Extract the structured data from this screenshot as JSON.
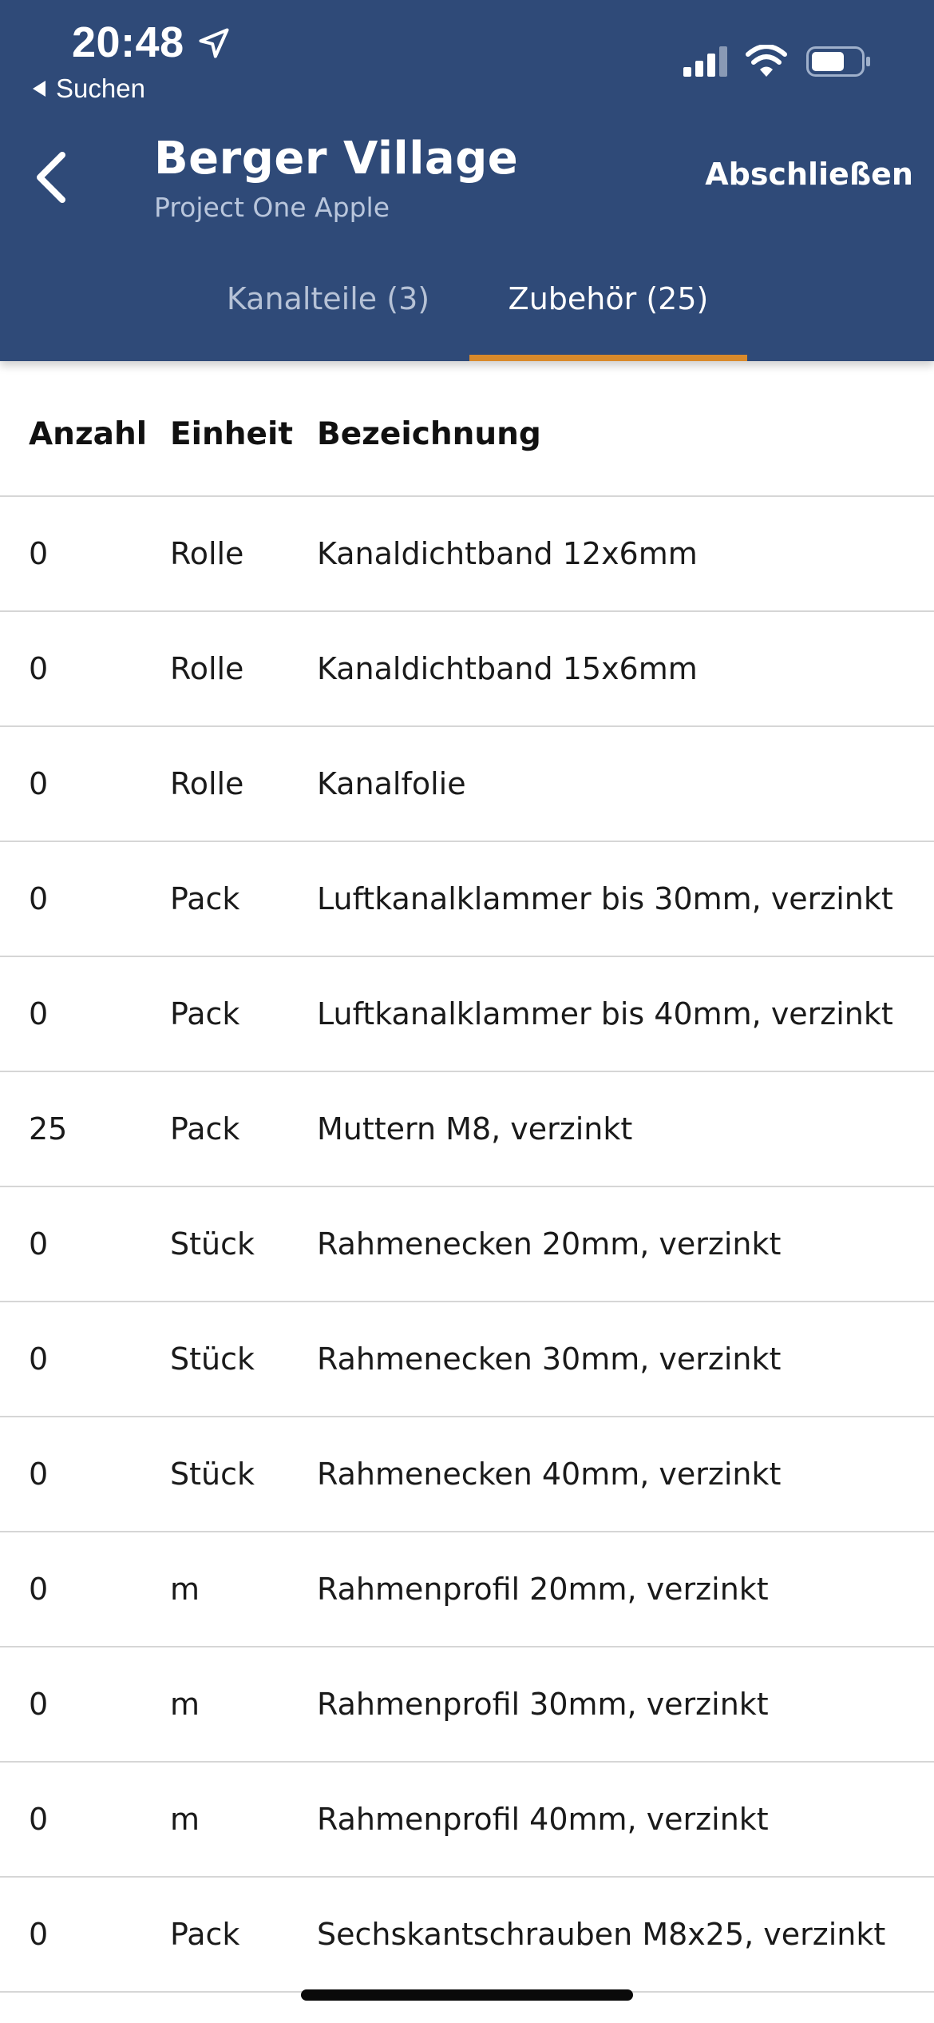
{
  "status_bar": {
    "time": "20:48",
    "back_app": "Suchen",
    "icons": [
      "location-arrow-icon",
      "cellular-signal-icon",
      "wifi-icon",
      "battery-icon"
    ]
  },
  "header": {
    "title": "Berger Village",
    "subtitle": "Project One Apple",
    "action": "Abschließen",
    "back_icon": "chevron-left-icon"
  },
  "tabs": [
    {
      "label": "Kanalteile (3)",
      "active": false
    },
    {
      "label": "Zubehör (25)",
      "active": true
    }
  ],
  "table": {
    "columns": [
      "Anzahl",
      "Einheit",
      "Bezeichnung"
    ],
    "rows": [
      {
        "anzahl": "0",
        "einheit": "Rolle",
        "bezeichnung": "Kanaldichtband 12x6mm"
      },
      {
        "anzahl": "0",
        "einheit": "Rolle",
        "bezeichnung": "Kanaldichtband 15x6mm"
      },
      {
        "anzahl": "0",
        "einheit": "Rolle",
        "bezeichnung": "Kanalfolie"
      },
      {
        "anzahl": "0",
        "einheit": "Pack",
        "bezeichnung": "Luftkanalklammer bis 30mm, verzinkt"
      },
      {
        "anzahl": "0",
        "einheit": "Pack",
        "bezeichnung": "Luftkanalklammer bis 40mm, verzinkt"
      },
      {
        "anzahl": "25",
        "einheit": "Pack",
        "bezeichnung": "Muttern M8, verzinkt"
      },
      {
        "anzahl": "0",
        "einheit": "Stück",
        "bezeichnung": "Rahmenecken 20mm, verzinkt"
      },
      {
        "anzahl": "0",
        "einheit": "Stück",
        "bezeichnung": "Rahmenecken 30mm, verzinkt"
      },
      {
        "anzahl": "0",
        "einheit": "Stück",
        "bezeichnung": "Rahmenecken 40mm, verzinkt"
      },
      {
        "anzahl": "0",
        "einheit": "m",
        "bezeichnung": "Rahmenprofil 20mm, verzinkt"
      },
      {
        "anzahl": "0",
        "einheit": "m",
        "bezeichnung": "Rahmenprofil 30mm, verzinkt"
      },
      {
        "anzahl": "0",
        "einheit": "m",
        "bezeichnung": "Rahmenprofil 40mm, verzinkt"
      },
      {
        "anzahl": "0",
        "einheit": "Pack",
        "bezeichnung": "Sechskantschrauben M8x25, verzinkt"
      }
    ]
  },
  "colors": {
    "header_bg": "#2f4a78",
    "tab_indicator": "#d98a2b",
    "subtitle": "#b9c6dc",
    "row_divider": "#d6d6d6"
  }
}
